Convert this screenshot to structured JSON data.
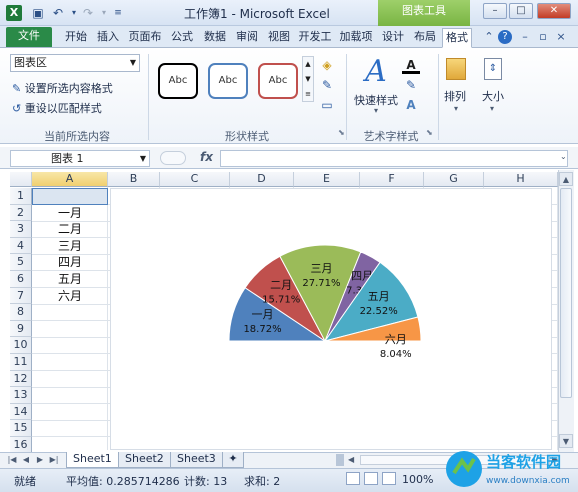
{
  "window": {
    "title": "工作簿1 - Microsoft Excel",
    "app_icon": "X",
    "context_tab": "图表工具",
    "minimize": "–",
    "maximize": "□",
    "close": "✕"
  },
  "ribbon_tabs": [
    "文件",
    "开始",
    "插入",
    "页面布",
    "公式",
    "数据",
    "审阅",
    "视图",
    "开发工",
    "加载项",
    "设计",
    "布局",
    "格式"
  ],
  "ribbon": {
    "current_selection": {
      "dropdown_value": "图表区",
      "format_selection": "设置所选内容格式",
      "reset_style": "重设以匹配样式",
      "group_label": "当前所选内容"
    },
    "shape_styles": {
      "swatches": [
        "Abc",
        "Abc",
        "Abc"
      ],
      "swatch_colors": [
        "#000000",
        "#4f81bd",
        "#c0504d"
      ],
      "group_label": "形状样式"
    },
    "wordart": {
      "quick_styles": "快速样式",
      "group_label": "艺术字样式"
    },
    "arrange": {
      "label": "排列"
    },
    "size": {
      "label": "大小"
    }
  },
  "formula_bar": {
    "name_box": "图表 1",
    "fx": "fx",
    "formula": ""
  },
  "sheet": {
    "columns": [
      "A",
      "B",
      "C",
      "D",
      "E",
      "F",
      "G",
      "H"
    ],
    "rows": [
      "1",
      "2",
      "3",
      "4",
      "5",
      "6",
      "7",
      "8",
      "9",
      "10",
      "11",
      "12",
      "13",
      "14",
      "15",
      "16"
    ],
    "column_a_values": [
      "",
      "一月",
      "二月",
      "三月",
      "四月",
      "五月",
      "六月"
    ]
  },
  "chart_data": {
    "type": "pie",
    "variant": "half-pie",
    "categories": [
      "一月",
      "二月",
      "三月",
      "四月",
      "五月",
      "六月"
    ],
    "values": [
      18.72,
      15.71,
      27.71,
      7.3,
      22.52,
      8.04
    ],
    "labels": [
      "18.72%",
      "15.71%",
      "27.71%",
      "7.30%",
      "22.52%",
      "8.04%"
    ],
    "colors": [
      "#4f81bd",
      "#c0504d",
      "#9bbb59",
      "#8064a2",
      "#4bacc6",
      "#f79646"
    ]
  },
  "sheet_tabs": [
    "Sheet1",
    "Sheet2",
    "Sheet3"
  ],
  "status": {
    "mode": "就绪",
    "average": "平均值: 0.285714286",
    "count": "计数: 13",
    "sum": "求和: 2",
    "zoom": "100%"
  },
  "watermark": {
    "text": "当客软件园",
    "url": "www.downxia.com",
    "colors": [
      "#1ea2e6",
      "#6cc24a"
    ]
  }
}
